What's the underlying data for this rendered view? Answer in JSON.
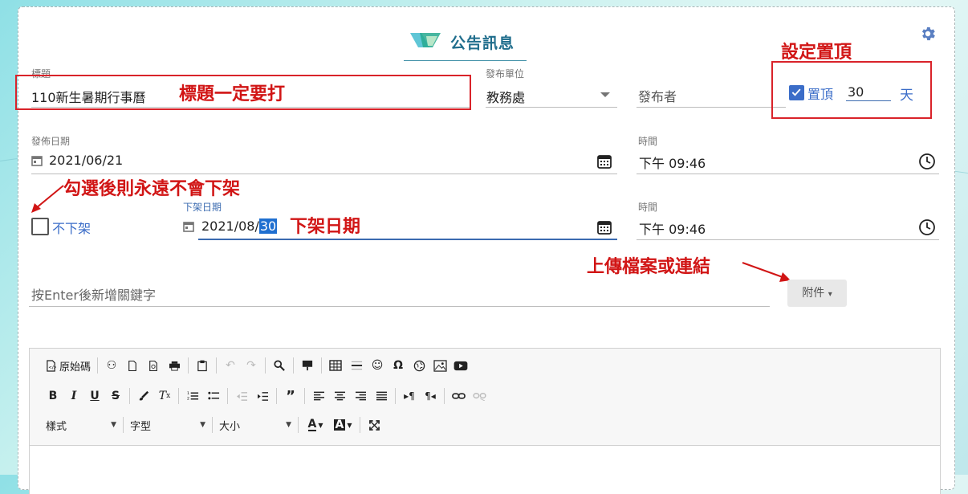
{
  "header": {
    "title": "公告訊息"
  },
  "title_field": {
    "label": "標題",
    "value": "110新生暑期行事曆"
  },
  "unit_field": {
    "label": "發布單位",
    "value": "教務處"
  },
  "publisher_field": {
    "placeholder": "發布者"
  },
  "pin": {
    "label": "置頂",
    "days": "30",
    "unit": "天",
    "checked": true
  },
  "publish_date": {
    "label": "發佈日期",
    "value": "2021/06/21"
  },
  "publish_time": {
    "label": "時間",
    "value": "下午 09:46"
  },
  "no_unpublish": {
    "label": "不下架",
    "checked": false
  },
  "unpublish_date": {
    "label": "下架日期",
    "value_prefix": "2021/08/",
    "value_selected": "30"
  },
  "unpublish_time": {
    "label": "時間",
    "value": "下午 09:46"
  },
  "keywords": {
    "placeholder": "按Enter後新增關鍵字"
  },
  "attach": {
    "label": "附件",
    "arrow": "▾"
  },
  "annotations": {
    "title_required": "標題一定要打",
    "set_pin": "設定置頂",
    "never_unpublish": "勾選後則永遠不會下架",
    "unpublish_date": "下架日期",
    "upload": "上傳檔案或連結"
  },
  "editor": {
    "source_label": "原始碼",
    "style_combo": "樣式",
    "font_combo": "字型",
    "size_combo": "大小"
  },
  "colors": {
    "accent": "#1f6d8c",
    "annotation_red": "#d11515",
    "checkbox_blue": "#3b6dc8",
    "active_underline": "#3b6bb0"
  }
}
